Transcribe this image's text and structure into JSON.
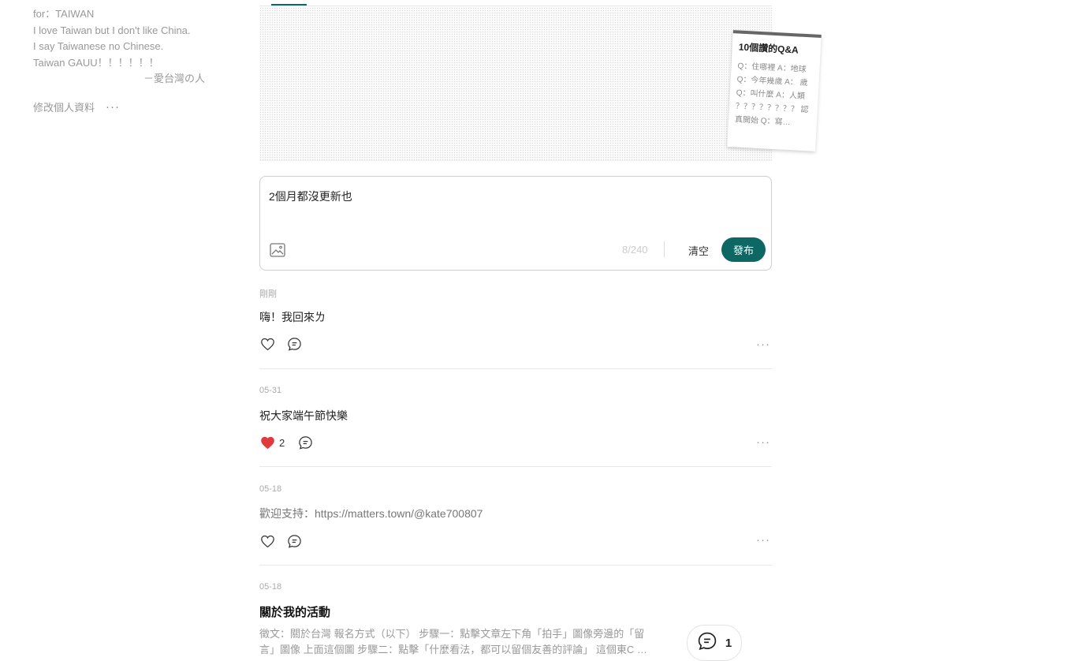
{
  "bio": {
    "lines": [
      "for：TAIWAN",
      "I love Taiwan but I don't like China.",
      "I say Taiwanese no Chinese.",
      "Taiwan GAUU！！！！！！"
    ],
    "signature": "－愛台灣の人",
    "edit_label": "修改個人資料",
    "more_label": "···"
  },
  "cover_card": {
    "title": "10個讚的Q&A",
    "body": "Q：住哪裡 A：地球 Q：今年幾歲 A： 歲 Q：叫什麼 A：人類 ？？？？？？？？ 認真開始 Q：寫…"
  },
  "composer": {
    "text": "2個月都沒更新也",
    "counter": "8/240",
    "clear_label": "清空",
    "publish_label": "發布"
  },
  "posts": [
    {
      "date": "剛剛",
      "text": "嗨！我回來ㄌ",
      "likes": "",
      "liked": false
    },
    {
      "date": "05-31",
      "text": "祝大家端午節快樂",
      "likes": "2",
      "liked": true
    },
    {
      "date": "05-18",
      "text": "歡迎支持：https://matters.town/@kate700807",
      "likes": "",
      "liked": false
    }
  ],
  "activity": {
    "date": "05-18",
    "title": "關於我的活動",
    "desc_line1": "徵文：關於台灣 報名方式（以下） 步驟一：點擊文章左下角「拍手」圖像旁邊的「留",
    "desc_line2": "言」圖像 上面這個圖 步驟二：點擊「什麼看法，都可以留個友善的評論」 這個東C …"
  },
  "comment_pill": {
    "count": "1"
  },
  "post_more_label": "···",
  "colors": {
    "accent": "#0d6763",
    "like": "#e03a3e"
  }
}
